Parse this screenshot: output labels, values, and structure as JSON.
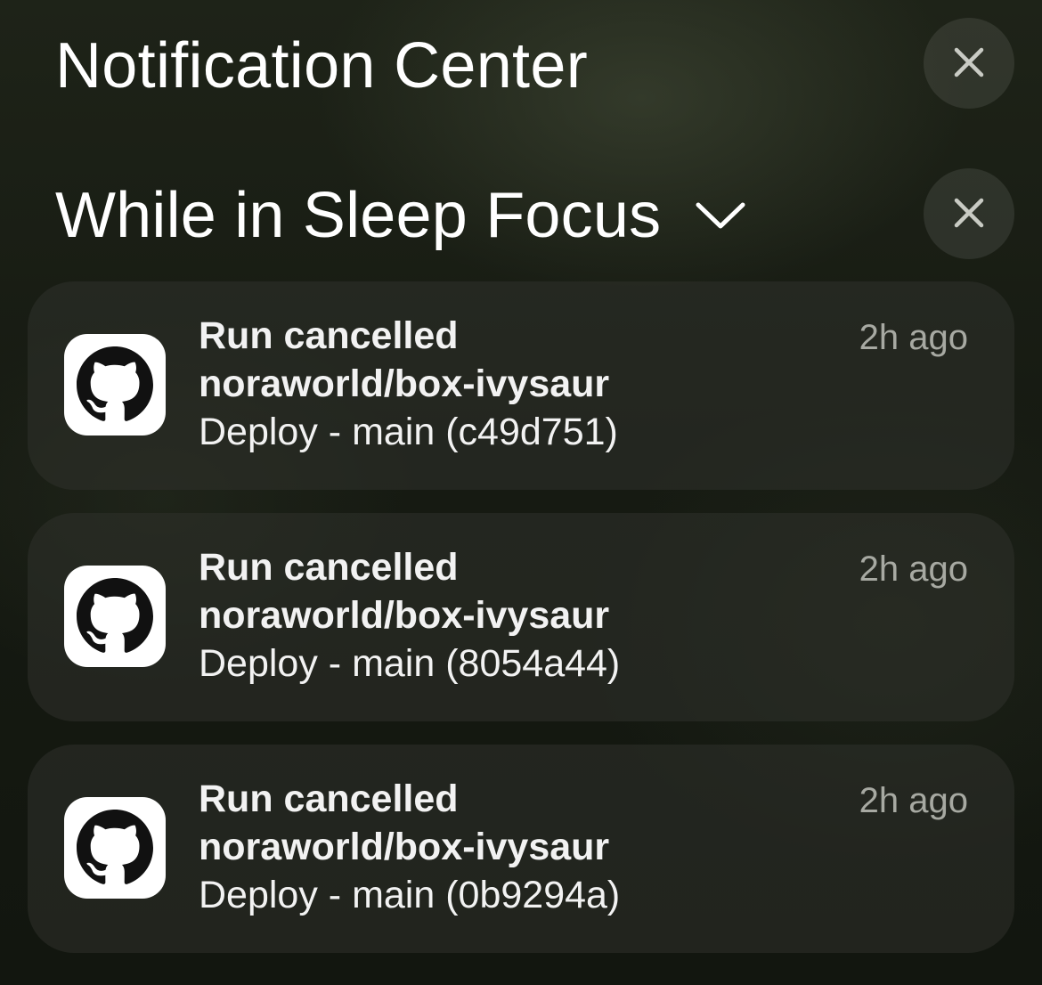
{
  "header": {
    "title": "Notification Center",
    "close_icon": "close-icon"
  },
  "group": {
    "title": "While in Sleep Focus",
    "chevron_icon": "chevron-down-icon",
    "close_icon": "close-icon"
  },
  "notifications": [
    {
      "app_icon": "github-icon",
      "title": "Run cancelled",
      "subtitle": "noraworld/box-ivysaur",
      "body": "Deploy - main (c49d751)",
      "time": "2h ago"
    },
    {
      "app_icon": "github-icon",
      "title": "Run cancelled",
      "subtitle": "noraworld/box-ivysaur",
      "body": "Deploy - main (8054a44)",
      "time": "2h ago"
    },
    {
      "app_icon": "github-icon",
      "title": "Run cancelled",
      "subtitle": "noraworld/box-ivysaur",
      "body": "Deploy - main (0b9294a)",
      "time": "2h ago"
    }
  ]
}
